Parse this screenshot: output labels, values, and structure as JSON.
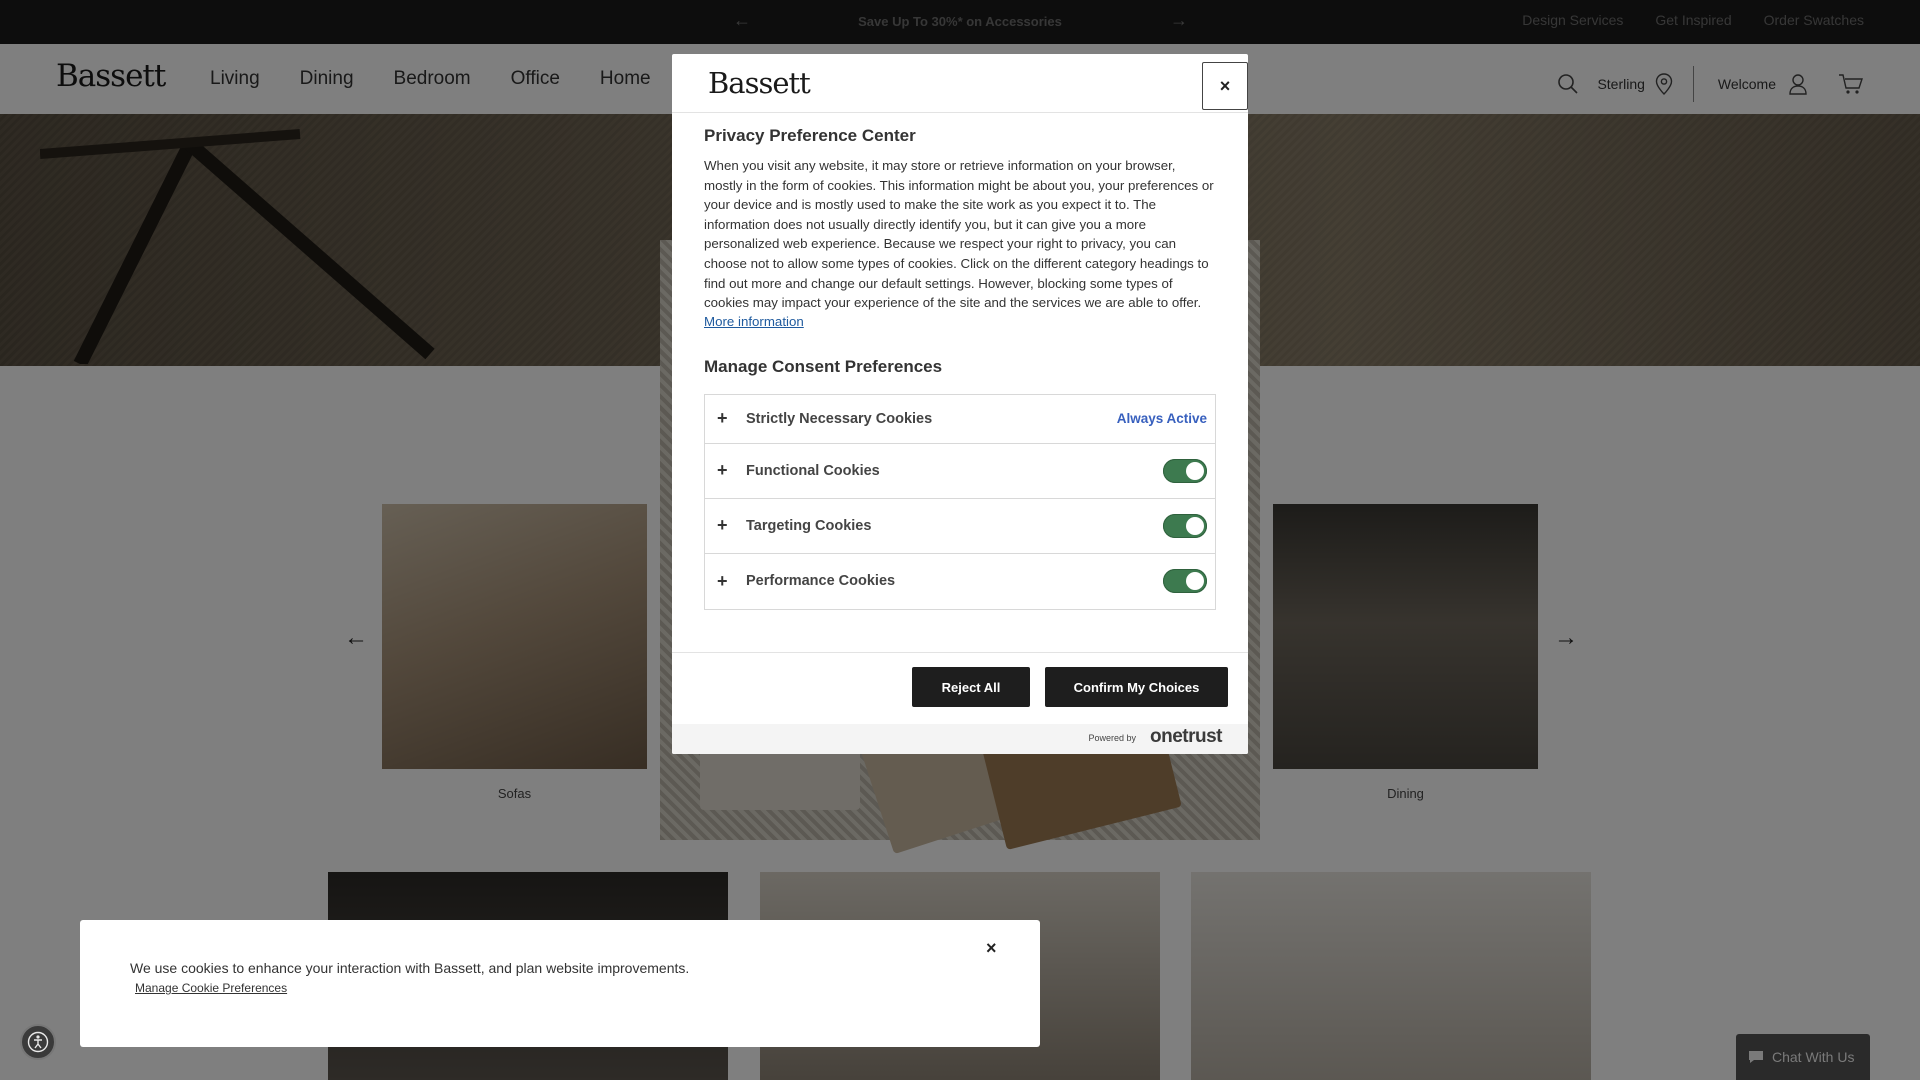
{
  "promo": {
    "text": "Save Up To 30%* on Accessories",
    "prev_arrow": "←",
    "next_arrow": "→"
  },
  "utility_links": [
    "Design Services",
    "Get Inspired",
    "Order Swatches"
  ],
  "header": {
    "logo": "Bassett",
    "nav": [
      "Living",
      "Dining",
      "Bedroom",
      "Office",
      "Home"
    ],
    "store": "Sterling",
    "account": "Welcome"
  },
  "page": {
    "categories": [
      "Sofas",
      "Dining"
    ],
    "carousel_prev": "←",
    "carousel_next": "→"
  },
  "privacy_modal": {
    "logo": "Bassett",
    "close_label": "×",
    "title": "Privacy Preference Center",
    "description": "When you visit any website, it may store or retrieve information on your browser, mostly in the form of cookies. This information might be about you, your preferences or your device and is mostly used to make the site work as you expect it to. The information does not usually directly identify you, but it can give you a more personalized web experience. Because we respect your right to privacy, you can choose not to allow some types of cookies. Click on the different category headings to find out more and change our default settings. However, blocking some types of cookies may impact your experience of the site and the services we are able to offer.",
    "more_info": "More information",
    "consent_title": "Manage Consent Preferences",
    "categories": [
      {
        "name": "Strictly Necessary Cookies",
        "status": "Always Active",
        "plus": "+"
      },
      {
        "name": "Functional Cookies",
        "enabled": true,
        "plus": "+"
      },
      {
        "name": "Targeting Cookies",
        "enabled": true,
        "plus": "+"
      },
      {
        "name": "Performance Cookies",
        "enabled": true,
        "plus": "+"
      }
    ],
    "reject_label": "Reject All",
    "confirm_label": "Confirm My Choices",
    "powered_by": "Powered by",
    "powered_brand": "onetrust"
  },
  "cookie_banner": {
    "text": "We use cookies to enhance your interaction with Bassett, and plan website improvements.",
    "link": "Manage Cookie Preferences",
    "close_label": "×"
  },
  "chat": {
    "label": "Chat With Us"
  },
  "colors": {
    "toggle_on": "#3d7a4f",
    "link_blue": "#1f5a9e",
    "always_active": "#3860be",
    "button_dark": "#1e1e1e"
  },
  "icons": [
    "search-icon",
    "location-pin-icon",
    "user-icon",
    "cart-icon",
    "accessibility-icon",
    "chat-bubble-icon"
  ]
}
